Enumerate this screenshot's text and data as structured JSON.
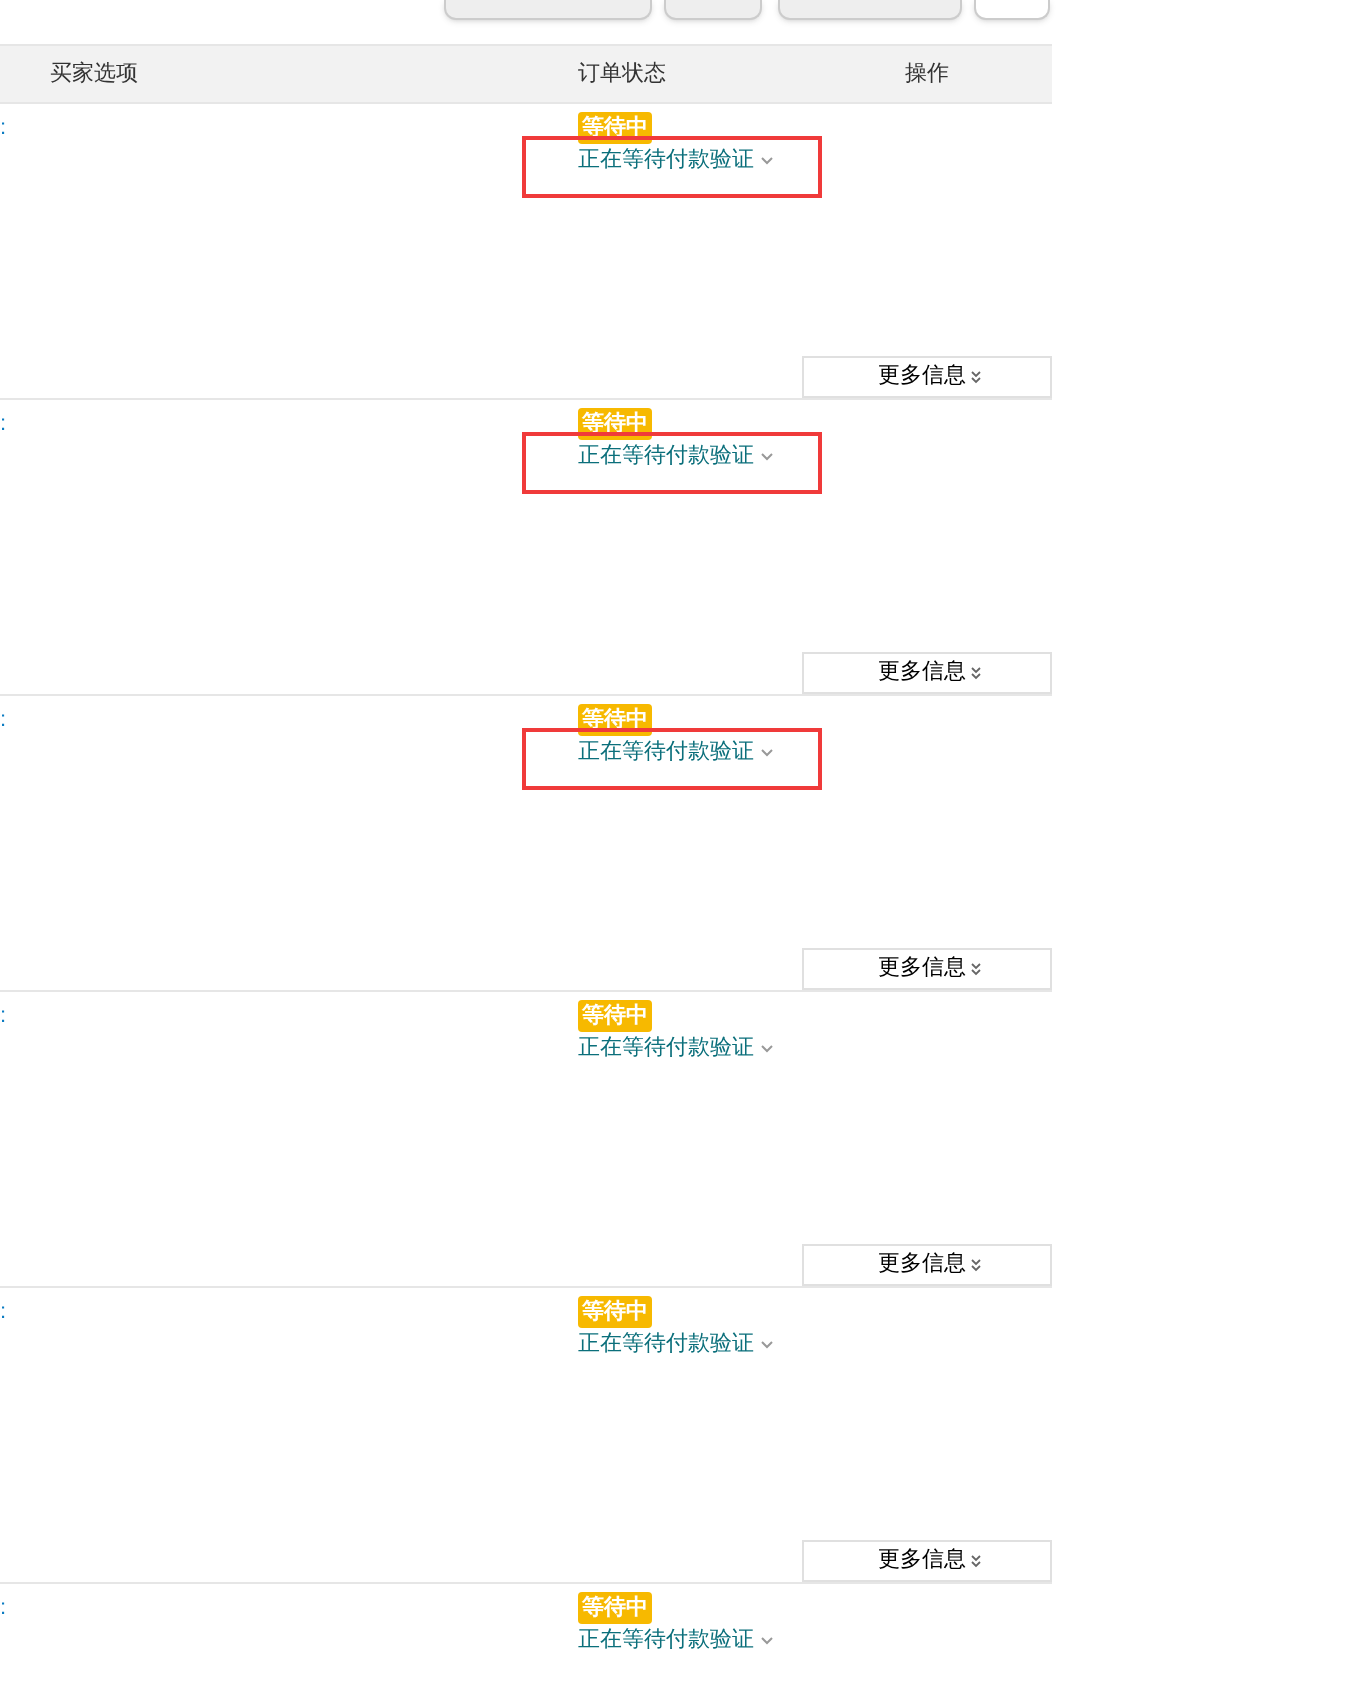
{
  "toolbar": {
    "buttons": [
      {
        "kind": "dropdown"
      },
      {
        "kind": "dropdown"
      },
      {
        "kind": "dropdown"
      },
      {
        "kind": "plain"
      }
    ]
  },
  "table": {
    "columns": [
      "买家选项",
      "订单状态",
      "操作"
    ],
    "rows": [
      {
        "column_1": ":",
        "badge": "等待中",
        "status": "正在等待付款验证",
        "highlighted": true,
        "more_button": "更多信息"
      },
      {
        "column_1": ":",
        "badge": "等待中",
        "status": "正在等待付款验证",
        "highlighted": true,
        "more_button": "更多信息"
      },
      {
        "column_1": ":",
        "badge": "等待中",
        "status": "正在等待付款验证",
        "highlighted": true,
        "more_button": "更多信息"
      },
      {
        "column_1": ":",
        "badge": "等待中",
        "status": "正在等待付款验证",
        "highlighted": false,
        "more_button": "更多信息"
      },
      {
        "column_1": ":",
        "badge": "等待中",
        "status": "正在等待付款验证",
        "highlighted": false,
        "more_button": "更多信息"
      },
      {
        "column_1": ":",
        "badge": "等待中",
        "status": "正在等待付款验证",
        "highlighted": false
      }
    ]
  }
}
